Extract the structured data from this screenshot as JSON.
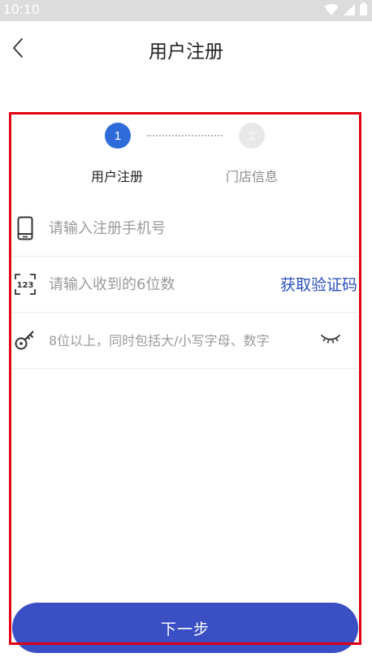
{
  "status_bar": {
    "time": "10:10",
    "icons": [
      "wifi-icon",
      "cellular-signal-icon",
      "battery-icon"
    ]
  },
  "header": {
    "title": "用户注册",
    "back_icon": "chevron-left-icon"
  },
  "stepper": {
    "steps": [
      {
        "number": "1",
        "label": "用户注册",
        "active": true
      },
      {
        "number": "2",
        "label": "门店信息",
        "active": false
      }
    ]
  },
  "form": {
    "phone": {
      "placeholder": "请输入注册手机号",
      "value": "",
      "icon": "phone-icon"
    },
    "code": {
      "placeholder": "请输入收到的6位数",
      "value": "",
      "icon": "numeric-code-icon",
      "get_code_label": "获取验证码"
    },
    "password": {
      "placeholder": "8位以上，同时包括大/小写字母、数字",
      "value": "",
      "icon": "key-icon",
      "visibility_icon": "eye-closed-icon"
    }
  },
  "next_button": {
    "label": "下一步"
  },
  "colors": {
    "accent": "#3b4fc4",
    "step_active": "#2f6bd9",
    "link": "#2b4fbd",
    "annotation": "#e00012"
  }
}
